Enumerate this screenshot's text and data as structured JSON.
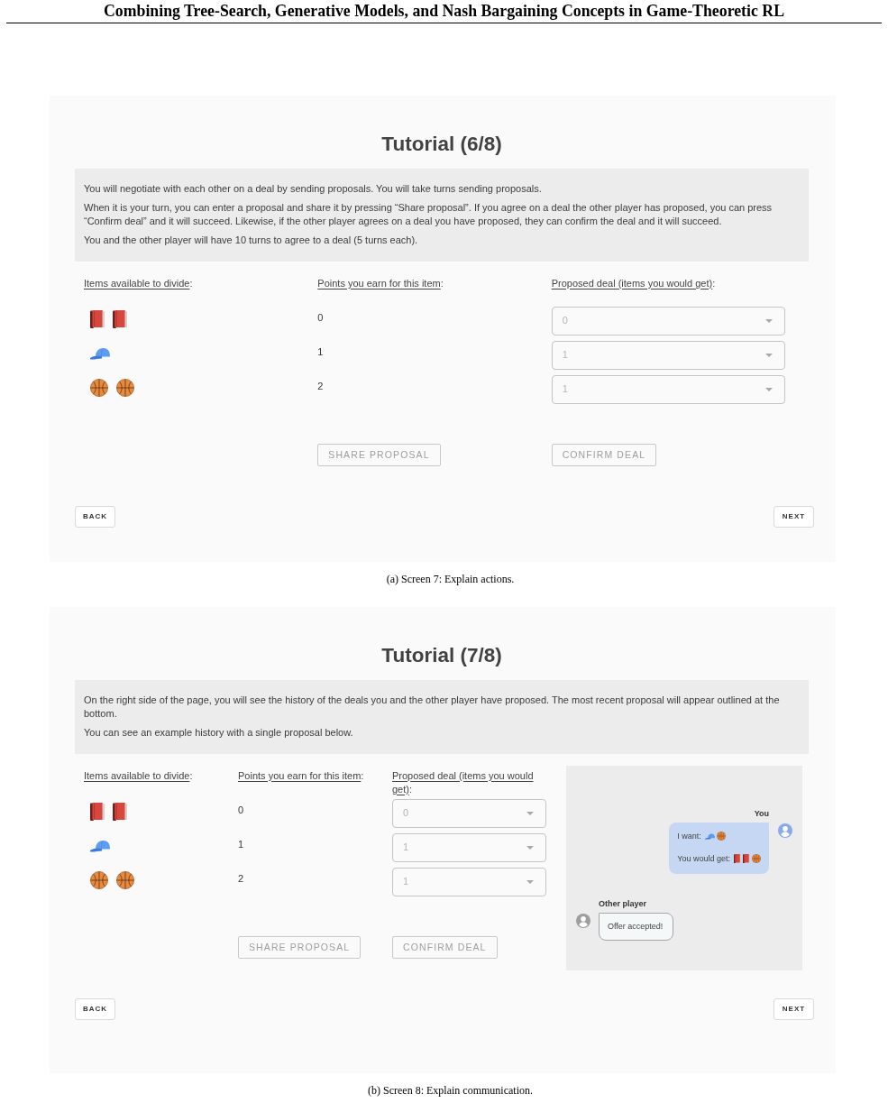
{
  "paper": {
    "title": "Combining Tree-Search, Generative Models, and Nash Bargaining Concepts in Game-Theoretic RL"
  },
  "figures": [
    {
      "screen": {
        "title": "Tutorial (6/8)",
        "paragraphs": [
          "You will negotiate with each other on a deal by sending proposals. You will take turns sending proposals.",
          "When it is your turn, you can enter a proposal and share it by pressing “Share proposal”. If you agree on a deal the other player has proposed, you can press “Confirm deal” and it will succeed. Likewise, if the other player agrees on a deal you have proposed, they can confirm the deal and it will succeed.",
          "You and the other player will have 10 turns to agree to a deal (5 turns each)."
        ],
        "columns": [
          {
            "label": "Items available to divide",
            "suffix": ":"
          },
          {
            "label": "Points you earn for this item",
            "suffix": ":"
          },
          {
            "label": "Proposed deal (items you would get)",
            "suffix": ":"
          }
        ],
        "rows": [
          {
            "items": [
              {
                "kind": "book"
              },
              {
                "kind": "book"
              }
            ],
            "points": "0",
            "proposal": {
              "value": "0",
              "disabled": true
            }
          },
          {
            "items": [
              {
                "kind": "cap"
              }
            ],
            "points": "1",
            "proposal": {
              "value": "1",
              "disabled": true
            }
          },
          {
            "items": [
              {
                "kind": "basketball"
              },
              {
                "kind": "basketball"
              }
            ],
            "points": "2",
            "proposal": {
              "value": "1",
              "disabled": true
            }
          }
        ],
        "actions": [
          {
            "label": "SHARE PROPOSAL",
            "disabled": true
          },
          {
            "label": "CONFIRM DEAL",
            "disabled": true
          }
        ],
        "navigation": [
          {
            "label": "BACK",
            "disabled": false
          },
          {
            "label": "NEXT",
            "disabled": false
          }
        ]
      },
      "caption": "(a) Screen 7: Explain actions."
    },
    {
      "screen": {
        "title": "Tutorial (7/8)",
        "paragraphs": [
          "On the right side of the page, you will see the history of the deals you and the other player have proposed. The most recent proposal will appear outlined at the bottom.",
          "You can see an example history with a single proposal below."
        ],
        "columns": [
          {
            "label": "Items available to divide",
            "suffix": ":"
          },
          {
            "label": "Points you earn for this item",
            "suffix": ":"
          },
          {
            "label": "Proposed deal (items you would get)",
            "suffix": ":"
          }
        ],
        "rows": [
          {
            "items": [
              {
                "kind": "book"
              },
              {
                "kind": "book"
              }
            ],
            "points": "0",
            "proposal": {
              "value": "0",
              "disabled": true
            }
          },
          {
            "items": [
              {
                "kind": "cap"
              }
            ],
            "points": "1",
            "proposal": {
              "value": "1",
              "disabled": true
            }
          },
          {
            "items": [
              {
                "kind": "basketball"
              },
              {
                "kind": "basketball"
              }
            ],
            "points": "2",
            "proposal": {
              "value": "1",
              "disabled": true
            }
          }
        ],
        "actions": [
          {
            "label": "SHARE PROPOSAL",
            "disabled": true
          },
          {
            "label": "CONFIRM DEAL",
            "disabled": true
          }
        ],
        "chat": {
          "messages": [
            {
              "kind": "own",
              "sender": "You",
              "lines": [
                {
                  "text": "I want:",
                  "items": [
                    {
                      "kind": "cap"
                    },
                    {
                      "kind": "basketball"
                    }
                  ]
                },
                {
                  "text": "You would get:",
                  "items": [
                    {
                      "kind": "book"
                    },
                    {
                      "kind": "book"
                    },
                    {
                      "kind": "basketball"
                    }
                  ]
                }
              ]
            },
            {
              "kind": "other",
              "sender": "Other player",
              "lines": [
                {
                  "text": "Offer accepted!"
                }
              ]
            }
          ]
        },
        "navigation": [
          {
            "label": "BACK",
            "disabled": false
          },
          {
            "label": "NEXT",
            "disabled": false
          }
        ]
      },
      "caption": "(b) Screen 8: Explain communication."
    }
  ]
}
